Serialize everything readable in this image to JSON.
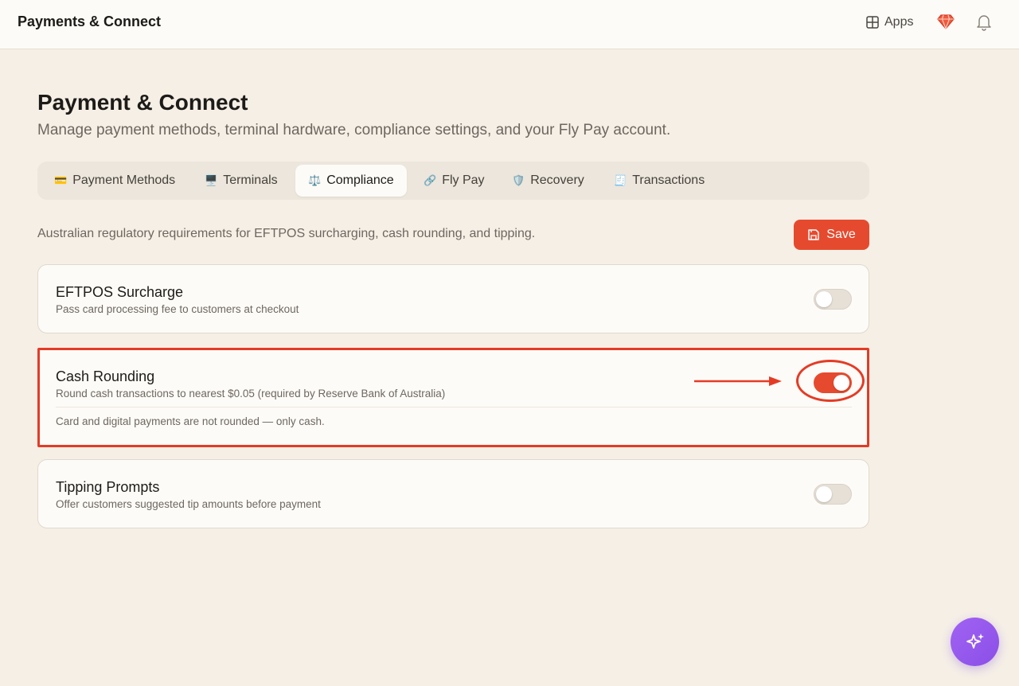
{
  "topbar": {
    "title": "Payments & Connect",
    "apps_label": "Apps",
    "icons": [
      "apps-grid-icon",
      "gem-icon",
      "bell-icon"
    ]
  },
  "header": {
    "title": "Payment & Connect",
    "subtitle": "Manage payment methods, terminal hardware, compliance settings, and your Fly Pay account."
  },
  "tabs": [
    {
      "emoji": "💳",
      "label": "Payment Methods",
      "active": false
    },
    {
      "emoji": "🖥️",
      "label": "Terminals",
      "active": false
    },
    {
      "emoji": "⚖️",
      "label": "Compliance",
      "active": true
    },
    {
      "emoji": "🔗",
      "label": "Fly Pay",
      "active": false
    },
    {
      "emoji": "🛡️",
      "label": "Recovery",
      "active": false
    },
    {
      "emoji": "🧾",
      "label": "Transactions",
      "active": false
    }
  ],
  "section": {
    "description": "Australian regulatory requirements for EFTPOS surcharging, cash rounding, and tipping.",
    "save_label": "Save"
  },
  "settings": [
    {
      "title": "EFTPOS Surcharge",
      "description": "Pass card processing fee to customers at checkout",
      "enabled": false
    },
    {
      "title": "Cash Rounding",
      "description": "Round cash transactions to nearest $0.05 (required by Reserve Bank of Australia)",
      "note": "Card and digital payments are not rounded — only cash.",
      "enabled": true
    },
    {
      "title": "Tipping Prompts",
      "description": "Offer customers suggested tip amounts before payment",
      "enabled": false
    }
  ],
  "colors": {
    "accent": "#e64a2e",
    "background": "#f5efe6",
    "annotation": "#e53b25",
    "fab": "#9a5cf0"
  }
}
